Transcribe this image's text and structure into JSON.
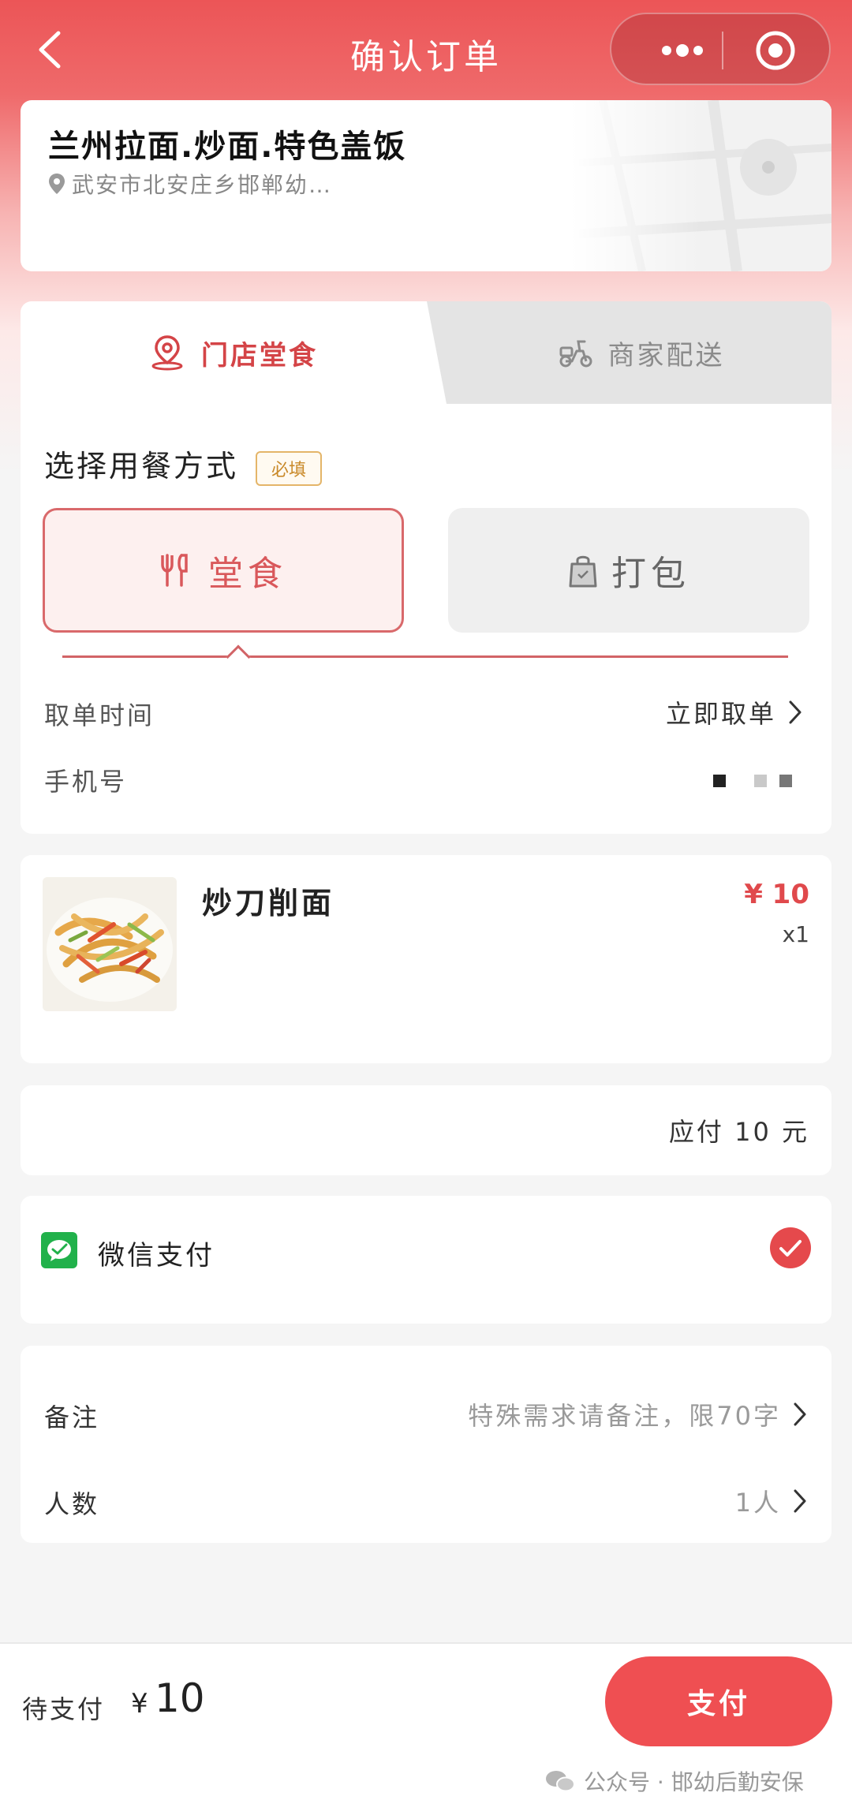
{
  "nav": {
    "title": "确认订单"
  },
  "store": {
    "name": "兰州拉面.炒面.特色盖饭",
    "address": "武安市北安庄乡邯郸幼…"
  },
  "tabs": [
    {
      "label": "门店堂食",
      "active": true
    },
    {
      "label": "商家配送",
      "active": false
    }
  ],
  "dining": {
    "section_label": "选择用餐方式",
    "required_badge": "必填",
    "options": [
      {
        "label": "堂食",
        "selected": true
      },
      {
        "label": "打包",
        "selected": false
      }
    ],
    "pickup_label": "取单时间",
    "pickup_value": "立即取单",
    "phone_label": "手机号"
  },
  "item": {
    "name": "炒刀削面",
    "price": "¥ 10",
    "quantity": "x1"
  },
  "summary": {
    "text": "应付 10 元"
  },
  "payment": {
    "method": "微信支付",
    "selected": true
  },
  "extras": {
    "notes_label": "备注",
    "notes_placeholder": "特殊需求请备注，限70字",
    "guests_label": "人数",
    "guests_value": "1人"
  },
  "bottom": {
    "due_label": "待支付",
    "currency_symbol": "¥",
    "due_amount": "10",
    "pay_button": "支付",
    "watermark": "公众号 · 邯幼后勤安保"
  },
  "colors": {
    "brand_red": "#ef4f52",
    "accent_red": "#d44447",
    "wechat_green": "#21b14b"
  }
}
